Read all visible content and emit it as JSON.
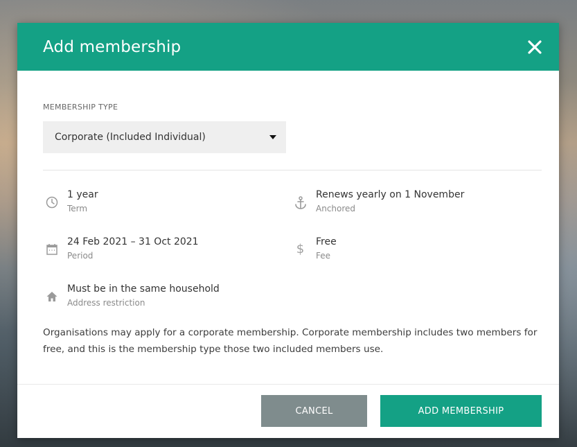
{
  "dialog": {
    "title": "Add membership",
    "close_icon": "close-icon",
    "accent_color": "#14a185"
  },
  "membership_type": {
    "label": "MEMBERSHIP TYPE",
    "selected": "Corporate (Included Individual)"
  },
  "details": {
    "term": {
      "icon": "clock-icon",
      "value": "1 year",
      "label": "Term"
    },
    "anchor": {
      "icon": "anchor-icon",
      "value": "Renews yearly on 1 November",
      "label": "Anchored"
    },
    "period": {
      "icon": "calendar-icon",
      "value": "24 Feb 2021 – 31 Oct 2021",
      "label": "Period"
    },
    "fee": {
      "icon": "dollar-icon",
      "value": "Free",
      "label": "Fee"
    },
    "address": {
      "icon": "home-icon",
      "value": "Must be in the same household",
      "label": "Address restriction"
    }
  },
  "description": "Organisations may apply for a corporate membership. Corporate membership includes two members for free, and this is the membership type those two included members use.",
  "footer": {
    "cancel_label": "CANCEL",
    "add_label": "ADD MEMBERSHIP",
    "cancel_color": "#7f8c8d"
  }
}
